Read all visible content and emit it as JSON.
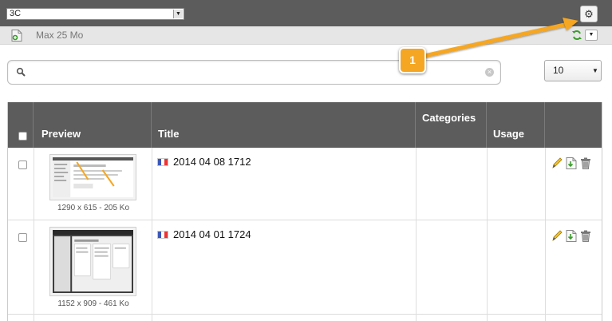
{
  "toolbar": {
    "folder_select_value": "3C",
    "quota_label": "Max 25 Mo"
  },
  "search": {
    "placeholder": "",
    "value": ""
  },
  "pagination": {
    "per_page": "10"
  },
  "table": {
    "columns": {
      "preview": "Preview",
      "title": "Title",
      "categories": "Categories",
      "usage": "Usage"
    },
    "rows": [
      {
        "title": "2014 04 08 1712",
        "dims": "1290 x 615 - 205 Ko",
        "categories": "",
        "usage": ""
      },
      {
        "title": "2014 04 01 1724",
        "dims": "1152 x 909 - 461 Ko",
        "categories": "",
        "usage": ""
      }
    ]
  },
  "callout": {
    "number": "1",
    "color": "#f5a623"
  },
  "colors": {
    "header_bg": "#5c5c5c",
    "accent_orange": "#f5a623"
  }
}
